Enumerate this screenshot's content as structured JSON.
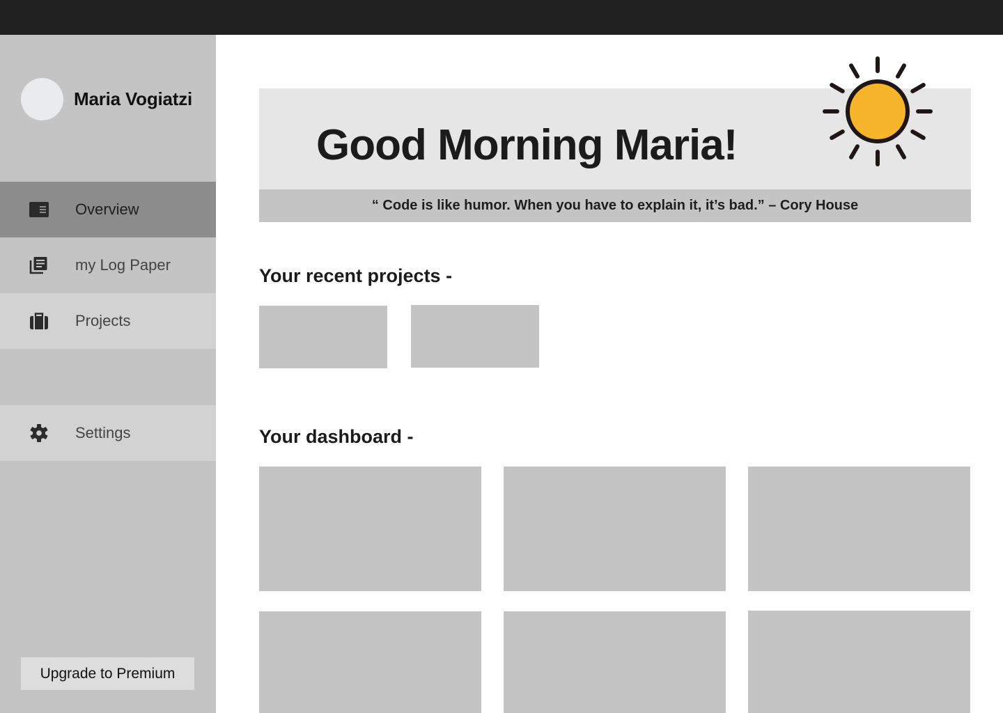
{
  "sidebar": {
    "profile_name": "Maria Vogiatzi",
    "items": [
      {
        "label": "Overview",
        "icon": "article-icon"
      },
      {
        "label": "my Log Paper",
        "icon": "library-books-icon"
      },
      {
        "label": "Projects",
        "icon": "briefcase-icon"
      },
      {
        "label": "Settings",
        "icon": "gear-icon"
      }
    ],
    "upgrade_label": "Upgrade to Premium"
  },
  "greeting": {
    "title": "Good Morning Maria!",
    "quote": "“ Code is like humor. When you have to explain it, it’s bad.” – Cory House",
    "weather_icon": "sun-icon",
    "sun_color": "#F7B52C"
  },
  "sections": {
    "recent_projects_title": "Your recent projects -",
    "dashboard_title": "Your dashboard -"
  },
  "colors": {
    "topbar": "#212121",
    "sidebar": "#c4c4c4",
    "active_item": "#8c8c8c",
    "placeholder": "#c4c4c4"
  }
}
